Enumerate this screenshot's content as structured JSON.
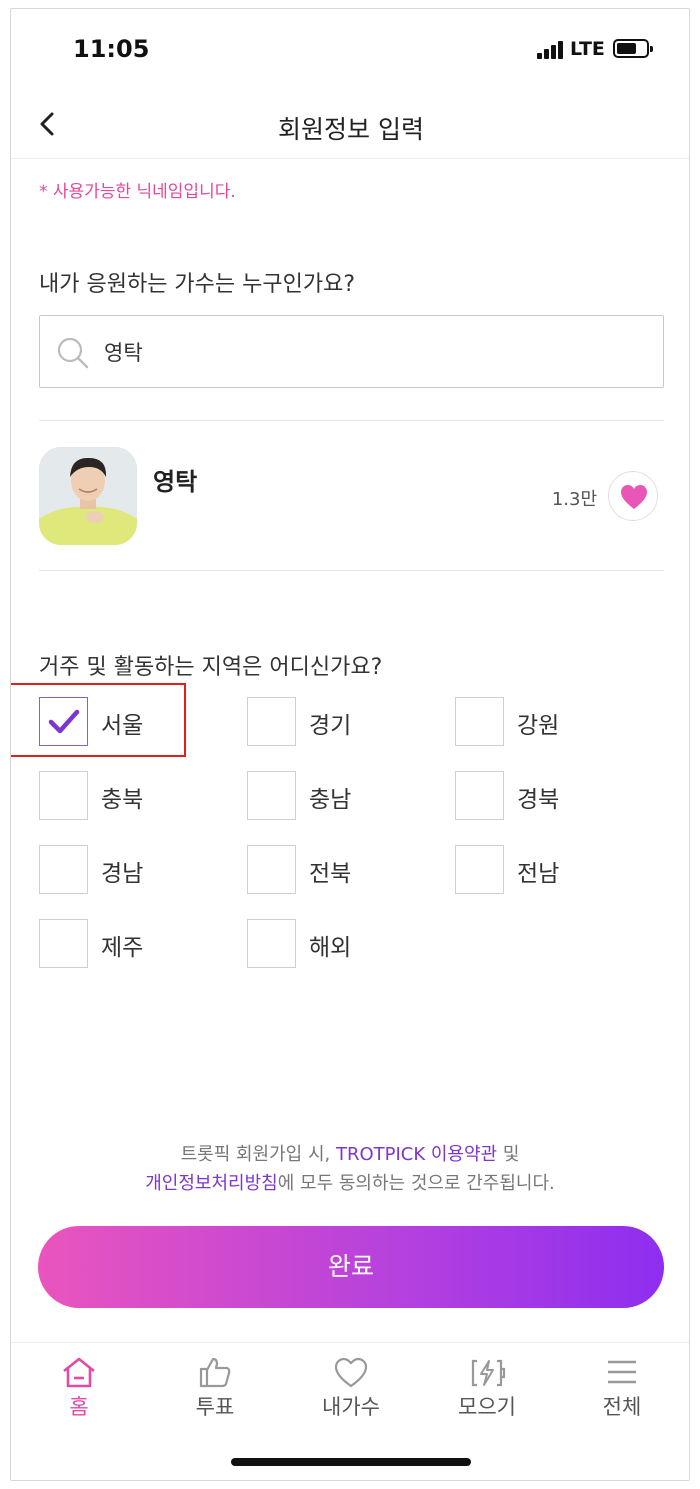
{
  "status_bar": {
    "time": "11:05",
    "network": "LTE"
  },
  "header": {
    "title": "회원정보 입력"
  },
  "nickname_notice": "* 사용가능한 닉네임입니다.",
  "singer_section": {
    "question": "내가 응원하는 가수는 누구인가요?",
    "search_value": "영탁",
    "result": {
      "name": "영탁",
      "count": "1.3만"
    }
  },
  "region_section": {
    "question": "거주 및 활동하는 지역은 어디신가요?",
    "regions": [
      {
        "label": "서울",
        "checked": true
      },
      {
        "label": "경기",
        "checked": false
      },
      {
        "label": "강원",
        "checked": false
      },
      {
        "label": "충북",
        "checked": false
      },
      {
        "label": "충남",
        "checked": false
      },
      {
        "label": "경북",
        "checked": false
      },
      {
        "label": "경남",
        "checked": false
      },
      {
        "label": "전북",
        "checked": false
      },
      {
        "label": "전남",
        "checked": false
      },
      {
        "label": "제주",
        "checked": false
      },
      {
        "label": "해외",
        "checked": false
      }
    ]
  },
  "terms": {
    "part1": "트롯픽 회원가입 시, ",
    "link1": "TROTPICK 이용약관",
    "part2": " 및",
    "link2": "개인정보처리방침",
    "part3": "에 모두 동의하는 것으로 간주됩니다."
  },
  "done_button": "완료",
  "tabbar": [
    {
      "label": "홈",
      "icon": "home-icon",
      "active": true
    },
    {
      "label": "투표",
      "icon": "thumbs-up-icon",
      "active": false
    },
    {
      "label": "내가수",
      "icon": "heart-icon",
      "active": false
    },
    {
      "label": "모으기",
      "icon": "charge-icon",
      "active": false
    },
    {
      "label": "전체",
      "icon": "menu-icon",
      "active": false
    }
  ],
  "colors": {
    "accent": "#e6479b",
    "purple": "#8e2ef0",
    "check": "#7d36cf"
  }
}
